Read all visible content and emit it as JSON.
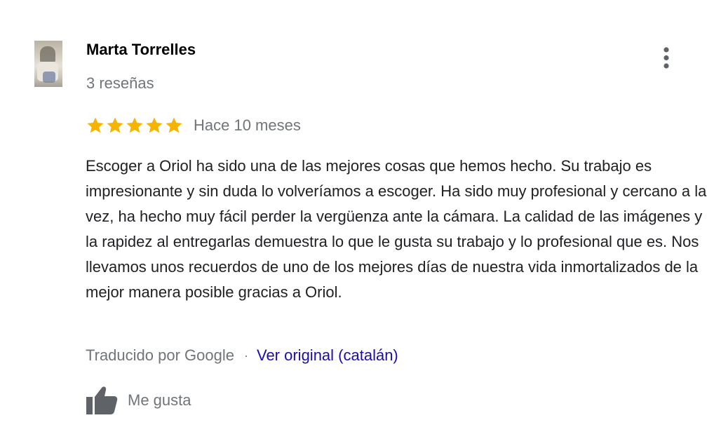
{
  "review": {
    "reviewer_name": "Marta Torrelles",
    "reviewer_reviews": "3 reseñas",
    "rating": 5,
    "rating_max": 5,
    "time_ago": "Hace 10 meses",
    "text": "Escoger a Oriol ha sido una de las mejores cosas que hemos hecho. Su trabajo es impresionante y sin duda lo volveríamos a escoger. Ha sido muy profesional y cercano a la vez, ha hecho muy fácil perder la vergüenza ante la cámara. La calidad de las imágenes y la rapidez al entregarlas demuestra lo que le gusta su trabajo y lo profesional que es. Nos llevamos unos recuerdos de uno de los mejores días de nuestra vida inmortalizados de la mejor manera posible gracias a Oriol.",
    "translated_by": "Traducido por Google",
    "separator": "·",
    "view_original": "Ver original (catalán)",
    "like_label": "Me gusta"
  },
  "icons": {
    "more": "more-vert-icon",
    "star": "star-icon",
    "like": "thumbs-up-icon"
  },
  "colors": {
    "star": "#f4b400",
    "link": "#1a0dab",
    "secondary_text": "#70757a",
    "icon": "#5f6368"
  }
}
